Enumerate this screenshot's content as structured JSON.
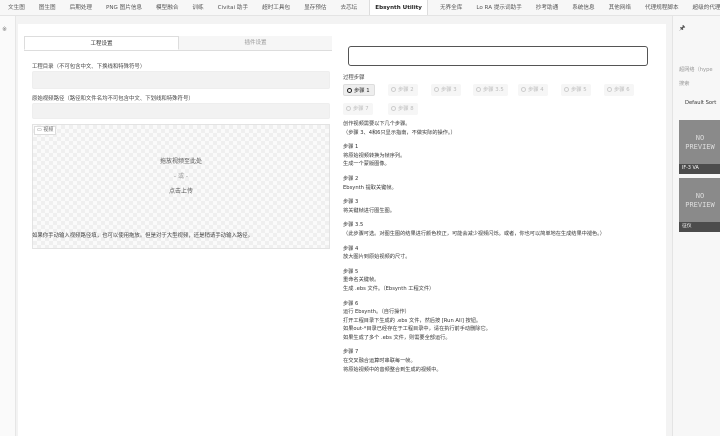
{
  "top_tabs": [
    "文生图",
    "图生图",
    "后期处理",
    "PNG 图片信息",
    "模型融合",
    "训练",
    "Civitai 助手",
    "超时工具包",
    "显存预估",
    "去芯坛",
    "Ebsynth Utility",
    "无界全库",
    "Lo RA 提示词助手",
    "抄考助通",
    "系统信息",
    "其他网络",
    "代理规程脚本",
    "超级的代理"
  ],
  "active_tab_index": 10,
  "left_panel": {
    "tabs": [
      "工程设置",
      "插件设置"
    ],
    "project_dir_label": "工程目录（不可包含中文、下换线和特殊符号）",
    "video_path_label": "原始视频路径（路径和文件名均不可包含中文、下划线和特殊符号）",
    "video_tag": "视频",
    "drop_text": "拖放视频至此处",
    "or_text": "- 或 -",
    "upload_text": "点击上传",
    "hint": "如果你手动输入视频路径填，也可以使用拖放。但是对于大型视频，还是稍请手动输入路径。"
  },
  "right_panel": {
    "process_label": "过程步骤",
    "step_options": [
      "步骤 1",
      "步骤 2",
      "步骤 3",
      "步骤 3.5",
      "步骤 4",
      "步骤 5",
      "步骤 6",
      "步骤 7",
      "步骤 8"
    ],
    "selected_step": "步骤 1",
    "intro": [
      "创作视频需要以下几个步骤。",
      "（步骤 3、4和6只显示指南，不做实际的操作。）"
    ],
    "steps": [
      {
        "title": "步骤 1",
        "lines": [
          "将原始视频转换为帧序列。",
          "生成一个蒙版图像。"
        ]
      },
      {
        "title": "步骤 2",
        "lines": [
          "Ebsynth 提取关键帧。"
        ]
      },
      {
        "title": "步骤 3",
        "lines": [
          "将关键帧进行图生图。"
        ]
      },
      {
        "title": "步骤 3.5",
        "lines": [
          "（此步骤可选。对图生图的结果进行颜色校正，可能会减少视频闪烁。或者，你也可以简单地在生成结果中褪色。）"
        ]
      },
      {
        "title": "步骤 4",
        "lines": [
          "放大图片到原始视频的尺寸。"
        ]
      },
      {
        "title": "步骤 5",
        "lines": [
          "重命名关键帧。",
          "生成 .ebs 文件。（Ebsynth 工程文件）"
        ]
      },
      {
        "title": "步骤 6",
        "lines": [
          "运行 Ebsynth。（自行操作）",
          "打开工程目录下生成的 .ebs 文件，然后按 [Run All] 按钮。",
          "如果out-*目录已经存在于工程目录中，请在执行前手动删除它。",
          "如果生成了多个 .ebs 文件，则需要全部运行。"
        ]
      },
      {
        "title": "步骤 7",
        "lines": [
          "在交叉融合运算时串联每一帧。",
          "将原始视频中的音频整合到生成的视频中。"
        ]
      }
    ]
  },
  "side_panel": {
    "pin_label": "🖈",
    "filter_text": "超网络（hype",
    "search_text": "搜索",
    "sort_label": "Default Sort",
    "thumbnails": [
      {
        "art": "NO\nPREVIEW",
        "caption": "IF-3 VA"
      },
      {
        "art": "NO\nPREVIEW",
        "caption": "征仪"
      }
    ]
  },
  "left_edge_mark": "※"
}
